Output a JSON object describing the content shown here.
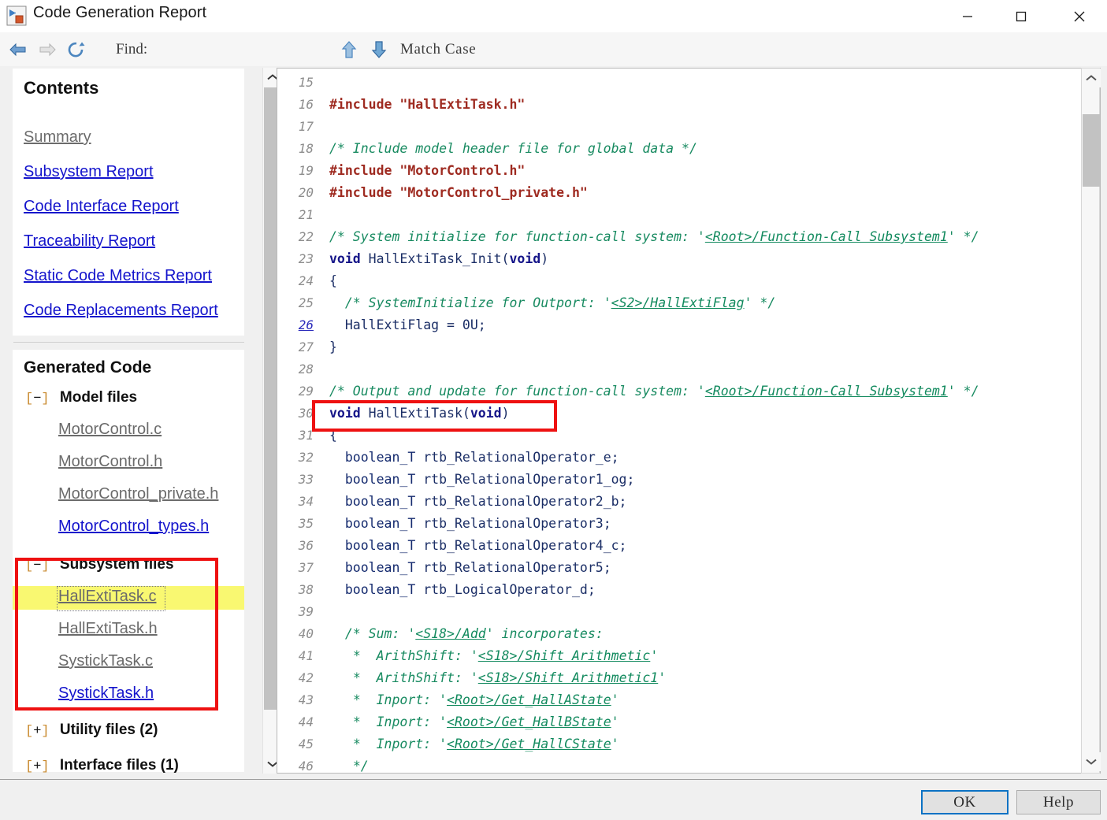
{
  "window": {
    "title": "Code Generation Report",
    "icon": "simulink-report-icon",
    "minimize_glyph": "—",
    "maximize_glyph": "□",
    "close_glyph": "✕"
  },
  "toolbar": {
    "back_icon": "back-arrow-icon",
    "forward_icon": "forward-arrow-icon",
    "refresh_icon": "refresh-icon",
    "find_label": "Find:",
    "find_value": "",
    "find_placeholder": "",
    "find_prev_icon": "arrow-up-icon",
    "find_next_icon": "arrow-down-icon",
    "match_case_label": "Match Case"
  },
  "sidebar": {
    "contents_heading": "Contents",
    "toc": [
      {
        "label": "Summary",
        "state": "visited"
      },
      {
        "label": "Subsystem Report",
        "state": "link"
      },
      {
        "label": "Code Interface Report",
        "state": "link"
      },
      {
        "label": "Traceability Report",
        "state": "link"
      },
      {
        "label": "Static Code Metrics Report",
        "state": "link"
      },
      {
        "label": "Code Replacements Report",
        "state": "link"
      }
    ],
    "generated_heading": "Generated Code",
    "groups": [
      {
        "marker_open": "[",
        "sign": "−",
        "marker_close": "]",
        "label": "Model files",
        "expanded": true,
        "files": [
          {
            "label": "MotorControl.c",
            "state": "visited"
          },
          {
            "label": "MotorControl.h",
            "state": "visited"
          },
          {
            "label": "MotorControl_private.h",
            "state": "visited"
          },
          {
            "label": "MotorControl_types.h",
            "state": "link"
          }
        ]
      },
      {
        "marker_open": "[",
        "sign": "−",
        "marker_close": "]",
        "label": "Subsystem files",
        "expanded": true,
        "files": [
          {
            "label": "HallExtiTask.c",
            "state": "selected"
          },
          {
            "label": "HallExtiTask.h",
            "state": "visited"
          },
          {
            "label": "SystickTask.c",
            "state": "visited"
          },
          {
            "label": "SystickTask.h",
            "state": "link"
          }
        ]
      },
      {
        "marker_open": "[",
        "sign": "+",
        "marker_close": "]",
        "label": "Utility files (2)",
        "expanded": false,
        "files": []
      },
      {
        "marker_open": "[",
        "sign": "+",
        "marker_close": "]",
        "label": "Interface files (1)",
        "expanded": false,
        "files": []
      }
    ],
    "scrollbar": {
      "up_glyph": "ⱏ",
      "down_glyph": "ⱟ"
    }
  },
  "code": {
    "first_line": 15,
    "lines": [
      {
        "n": "15",
        "html": ""
      },
      {
        "n": "16",
        "html": "<span class='pp'>#include \"HallExtiTask.h\"</span>"
      },
      {
        "n": "17",
        "html": ""
      },
      {
        "n": "18",
        "html": "<span class='cm'>/* Include model header file for global data */</span>"
      },
      {
        "n": "19",
        "html": "<span class='pp'>#include \"MotorControl.h\"</span>"
      },
      {
        "n": "20",
        "html": "<span class='pp'>#include \"MotorControl_private.h\"</span>"
      },
      {
        "n": "21",
        "html": ""
      },
      {
        "n": "22",
        "html": "<span class='cm'>/* System initialize for function-call system: '</span><span class='cmlink'>&lt;Root&gt;/Function-Call Subsystem1</span><span class='cm'>' */</span>"
      },
      {
        "n": "23",
        "html": "<span class='k'>void</span><span class='id'> HallExtiTask_Init(</span><span class='k'>void</span><span class='id'>)</span>"
      },
      {
        "n": "24",
        "html": "<span class='id'>{</span>"
      },
      {
        "n": "25",
        "html": "  <span class='cm'>/* SystemInitialize for Outport: '</span><span class='cmlink'>&lt;S2&gt;/HallExtiFlag</span><span class='cm'>' */</span>"
      },
      {
        "n": "26",
        "html": "  <span class='id'>HallExtiFlag = 0U;</span>",
        "line_is_link": true
      },
      {
        "n": "27",
        "html": "<span class='id'>}</span>"
      },
      {
        "n": "28",
        "html": ""
      },
      {
        "n": "29",
        "html": "<span class='cm'>/* Output and update for function-call system: '</span><span class='cmlink'>&lt;Root&gt;/Function-Call Subsystem1</span><span class='cm'>' */</span>"
      },
      {
        "n": "30",
        "html": "<span class='k'>void</span><span class='id'> HallExtiTask(</span><span class='k'>void</span><span class='id'>)</span>"
      },
      {
        "n": "31",
        "html": "<span class='id'>{</span>"
      },
      {
        "n": "32",
        "html": "  <span class='ty'>boolean_T</span><span class='id'> rtb_RelationalOperator_e;</span>"
      },
      {
        "n": "33",
        "html": "  <span class='ty'>boolean_T</span><span class='id'> rtb_RelationalOperator1_og;</span>"
      },
      {
        "n": "34",
        "html": "  <span class='ty'>boolean_T</span><span class='id'> rtb_RelationalOperator2_b;</span>"
      },
      {
        "n": "35",
        "html": "  <span class='ty'>boolean_T</span><span class='id'> rtb_RelationalOperator3;</span>"
      },
      {
        "n": "36",
        "html": "  <span class='ty'>boolean_T</span><span class='id'> rtb_RelationalOperator4_c;</span>"
      },
      {
        "n": "37",
        "html": "  <span class='ty'>boolean_T</span><span class='id'> rtb_RelationalOperator5;</span>"
      },
      {
        "n": "38",
        "html": "  <span class='ty'>boolean_T</span><span class='id'> rtb_LogicalOperator_d;</span>"
      },
      {
        "n": "39",
        "html": ""
      },
      {
        "n": "40",
        "html": "  <span class='cm'>/* Sum: '</span><span class='cmlink'>&lt;S18&gt;/Add</span><span class='cm'>' incorporates:</span>"
      },
      {
        "n": "41",
        "html": "   <span class='cm'>*  ArithShift: '</span><span class='cmlink'>&lt;S18&gt;/Shift Arithmetic</span><span class='cm'>'</span>"
      },
      {
        "n": "42",
        "html": "   <span class='cm'>*  ArithShift: '</span><span class='cmlink'>&lt;S18&gt;/Shift Arithmetic1</span><span class='cm'>'</span>"
      },
      {
        "n": "43",
        "html": "   <span class='cm'>*  Inport: '</span><span class='cmlink'>&lt;Root&gt;/Get_HallAState</span><span class='cm'>'</span>"
      },
      {
        "n": "44",
        "html": "   <span class='cm'>*  Inport: '</span><span class='cmlink'>&lt;Root&gt;/Get_HallBState</span><span class='cm'>'</span>"
      },
      {
        "n": "45",
        "html": "   <span class='cm'>*  Inport: '</span><span class='cmlink'>&lt;Root&gt;/Get_HallCState</span><span class='cm'>'</span>"
      },
      {
        "n": "46",
        "html": "   <span class='cm'>*/</span>"
      }
    ],
    "scrollbar": {
      "up_glyph": "ⱏ",
      "down_glyph": "ⱟ"
    }
  },
  "footer": {
    "ok_label": "OK",
    "help_label": "Help"
  },
  "annotations": {
    "highlight_color": "#f9f871",
    "box_color": "#ee1111",
    "boxes": [
      {
        "name": "subsystem-files-annotation"
      },
      {
        "name": "function-signature-annotation"
      }
    ]
  }
}
